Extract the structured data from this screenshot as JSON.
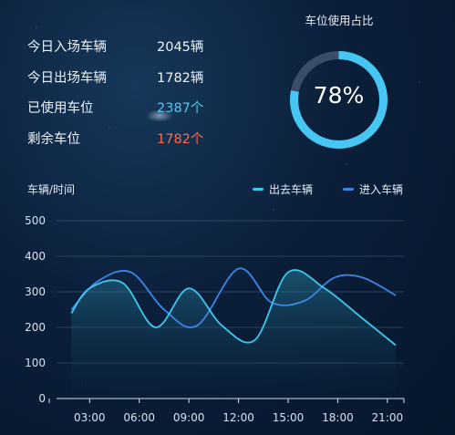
{
  "stats": [
    {
      "label": "今日入场车辆",
      "value": "2045辆",
      "color": "#eef3fa"
    },
    {
      "label": "今日出场车辆",
      "value": "1782辆",
      "color": "#eef3fa"
    },
    {
      "label": "已使用车位",
      "value": "2387个",
      "color": "#54c8f0"
    },
    {
      "label": "剩余车位",
      "value": "1782个",
      "color": "#ff6a4a"
    }
  ],
  "gauge": {
    "title": "车位使用占比",
    "percent_text": "78%",
    "percent": 78,
    "ring_color": "#46c6f2",
    "track_color": "#3b4e69"
  },
  "chart_data": {
    "type": "line",
    "ylabel": "车辆/时间",
    "categories": [
      "03:00",
      "06:00",
      "09:00",
      "12:00",
      "15:00",
      "18:00",
      "21:00"
    ],
    "ylim": [
      0,
      500
    ],
    "yticks": [
      0,
      100,
      200,
      300,
      400,
      500
    ],
    "grid": true,
    "legend_position": "top-right",
    "series": [
      {
        "name": "出去车辆",
        "color": "#3ec9f0",
        "x": [
          1.9,
          3,
          5,
          7,
          9,
          11,
          13,
          15,
          17.2,
          19.5,
          21.5
        ],
        "y": [
          240,
          310,
          325,
          200,
          310,
          205,
          165,
          355,
          310,
          225,
          150
        ]
      },
      {
        "name": "进入车辆",
        "color": "#3d86e8",
        "x": [
          1.9,
          3.5,
          5.5,
          7.5,
          9.5,
          12,
          14,
          16,
          17.8,
          19.5,
          21.5
        ],
        "y": [
          250,
          330,
          355,
          250,
          205,
          365,
          270,
          275,
          340,
          340,
          290
        ]
      }
    ]
  }
}
